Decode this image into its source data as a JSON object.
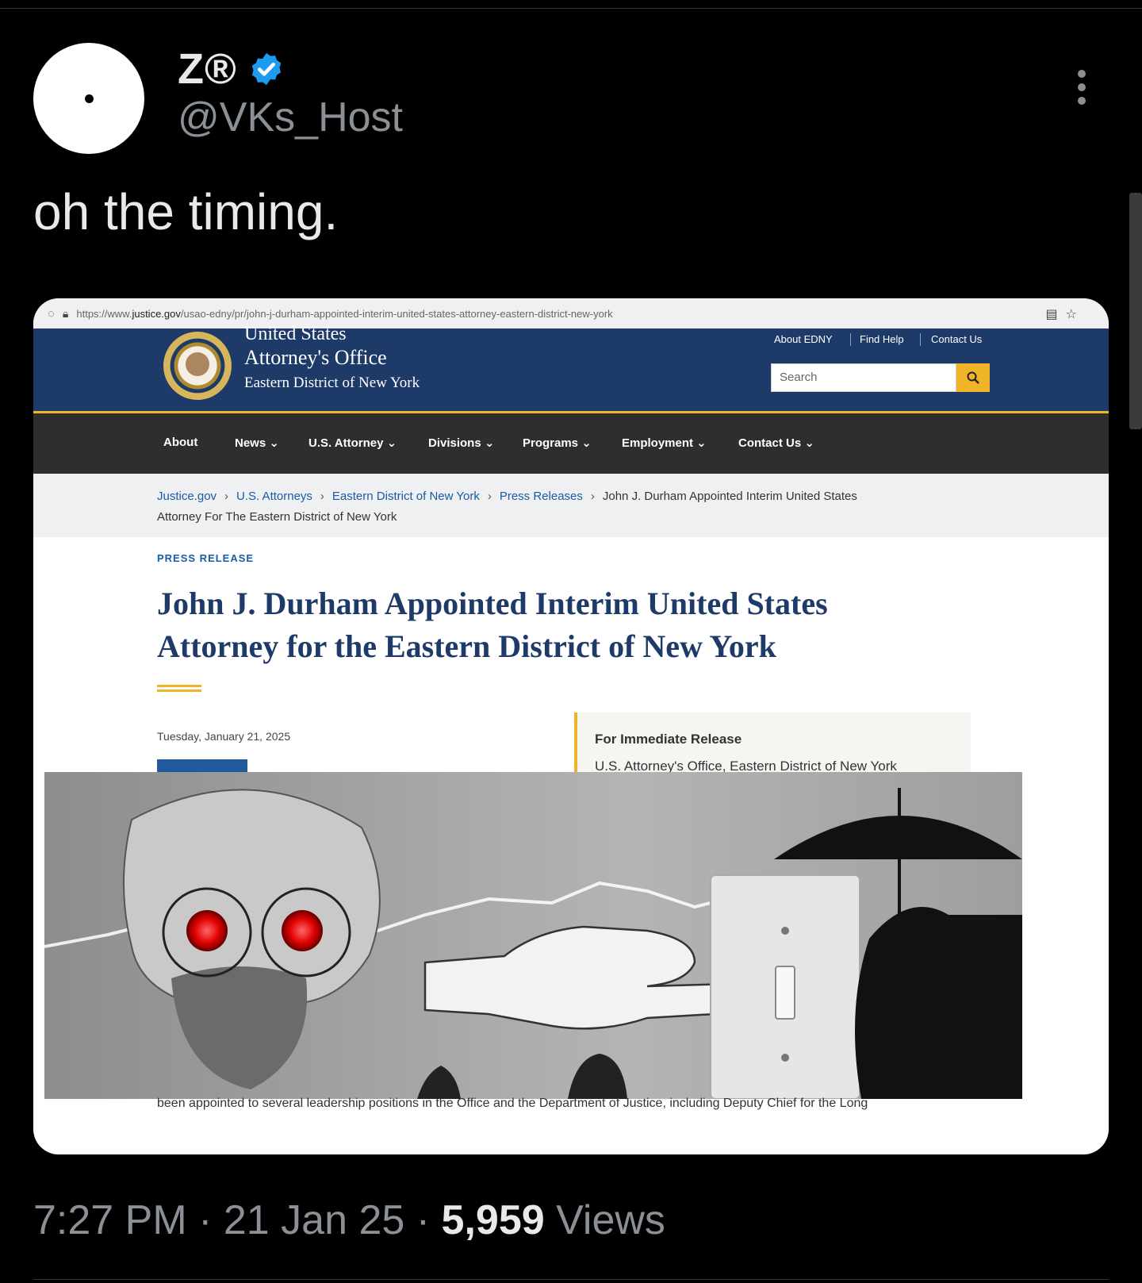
{
  "tweet": {
    "display_name": "Z®",
    "handle": "@VKs_Host",
    "text": "oh the timing.",
    "time": "7:27 PM",
    "date": "21 Jan 25",
    "views_count": "5,959",
    "views_label": "Views",
    "separator": "·"
  },
  "browser": {
    "url_prefix": "https://www.",
    "url_domain": "justice.gov",
    "url_path": "/usao-edny/pr/john-j-durham-appointed-interim-united-states-attorney-eastern-district-new-york"
  },
  "site": {
    "title_line1": "United States",
    "title_line2": "Attorney's Office",
    "title_line3": "Eastern District of New York",
    "utility_links": [
      "About EDNY",
      "Find Help",
      "Contact Us"
    ],
    "search_placeholder": "Search",
    "nav": [
      "About",
      "News",
      "U.S. Attorney",
      "Divisions",
      "Programs",
      "Employment",
      "Contact Us"
    ],
    "breadcrumbs": [
      "Justice.gov",
      "U.S. Attorneys",
      "Eastern District of New York",
      "Press Releases"
    ],
    "breadcrumb_current_line1": "John J. Durham Appointed Interim United States",
    "breadcrumb_current_line2": "Attorney For The Eastern District of New York"
  },
  "article": {
    "kicker": "PRESS RELEASE",
    "headline_line1": "John J. Durham Appointed Interim United States",
    "headline_line2": "Attorney for the Eastern District of New York",
    "date": "Tuesday, January 21, 2025",
    "release_title": "For Immediate Release",
    "release_office": "U.S. Attorney's Office, Eastern District of New York",
    "body_snippet": "been appointed to several leadership positions in the Office and the Department of Justice, including Deputy Chief for the Long"
  },
  "colors": {
    "background": "#000000",
    "verified_blue": "#1d9bf0",
    "site_navy": "#1e3a68",
    "site_gold": "#f0b429",
    "nav_dark": "#2e2e2e"
  },
  "icons": {
    "verified": "verified-badge-icon",
    "more": "more-options-icon",
    "search": "search-icon",
    "lock": "lock-icon",
    "shield": "shield-icon",
    "reader": "reader-mode-icon",
    "star": "bookmark-star-icon"
  }
}
